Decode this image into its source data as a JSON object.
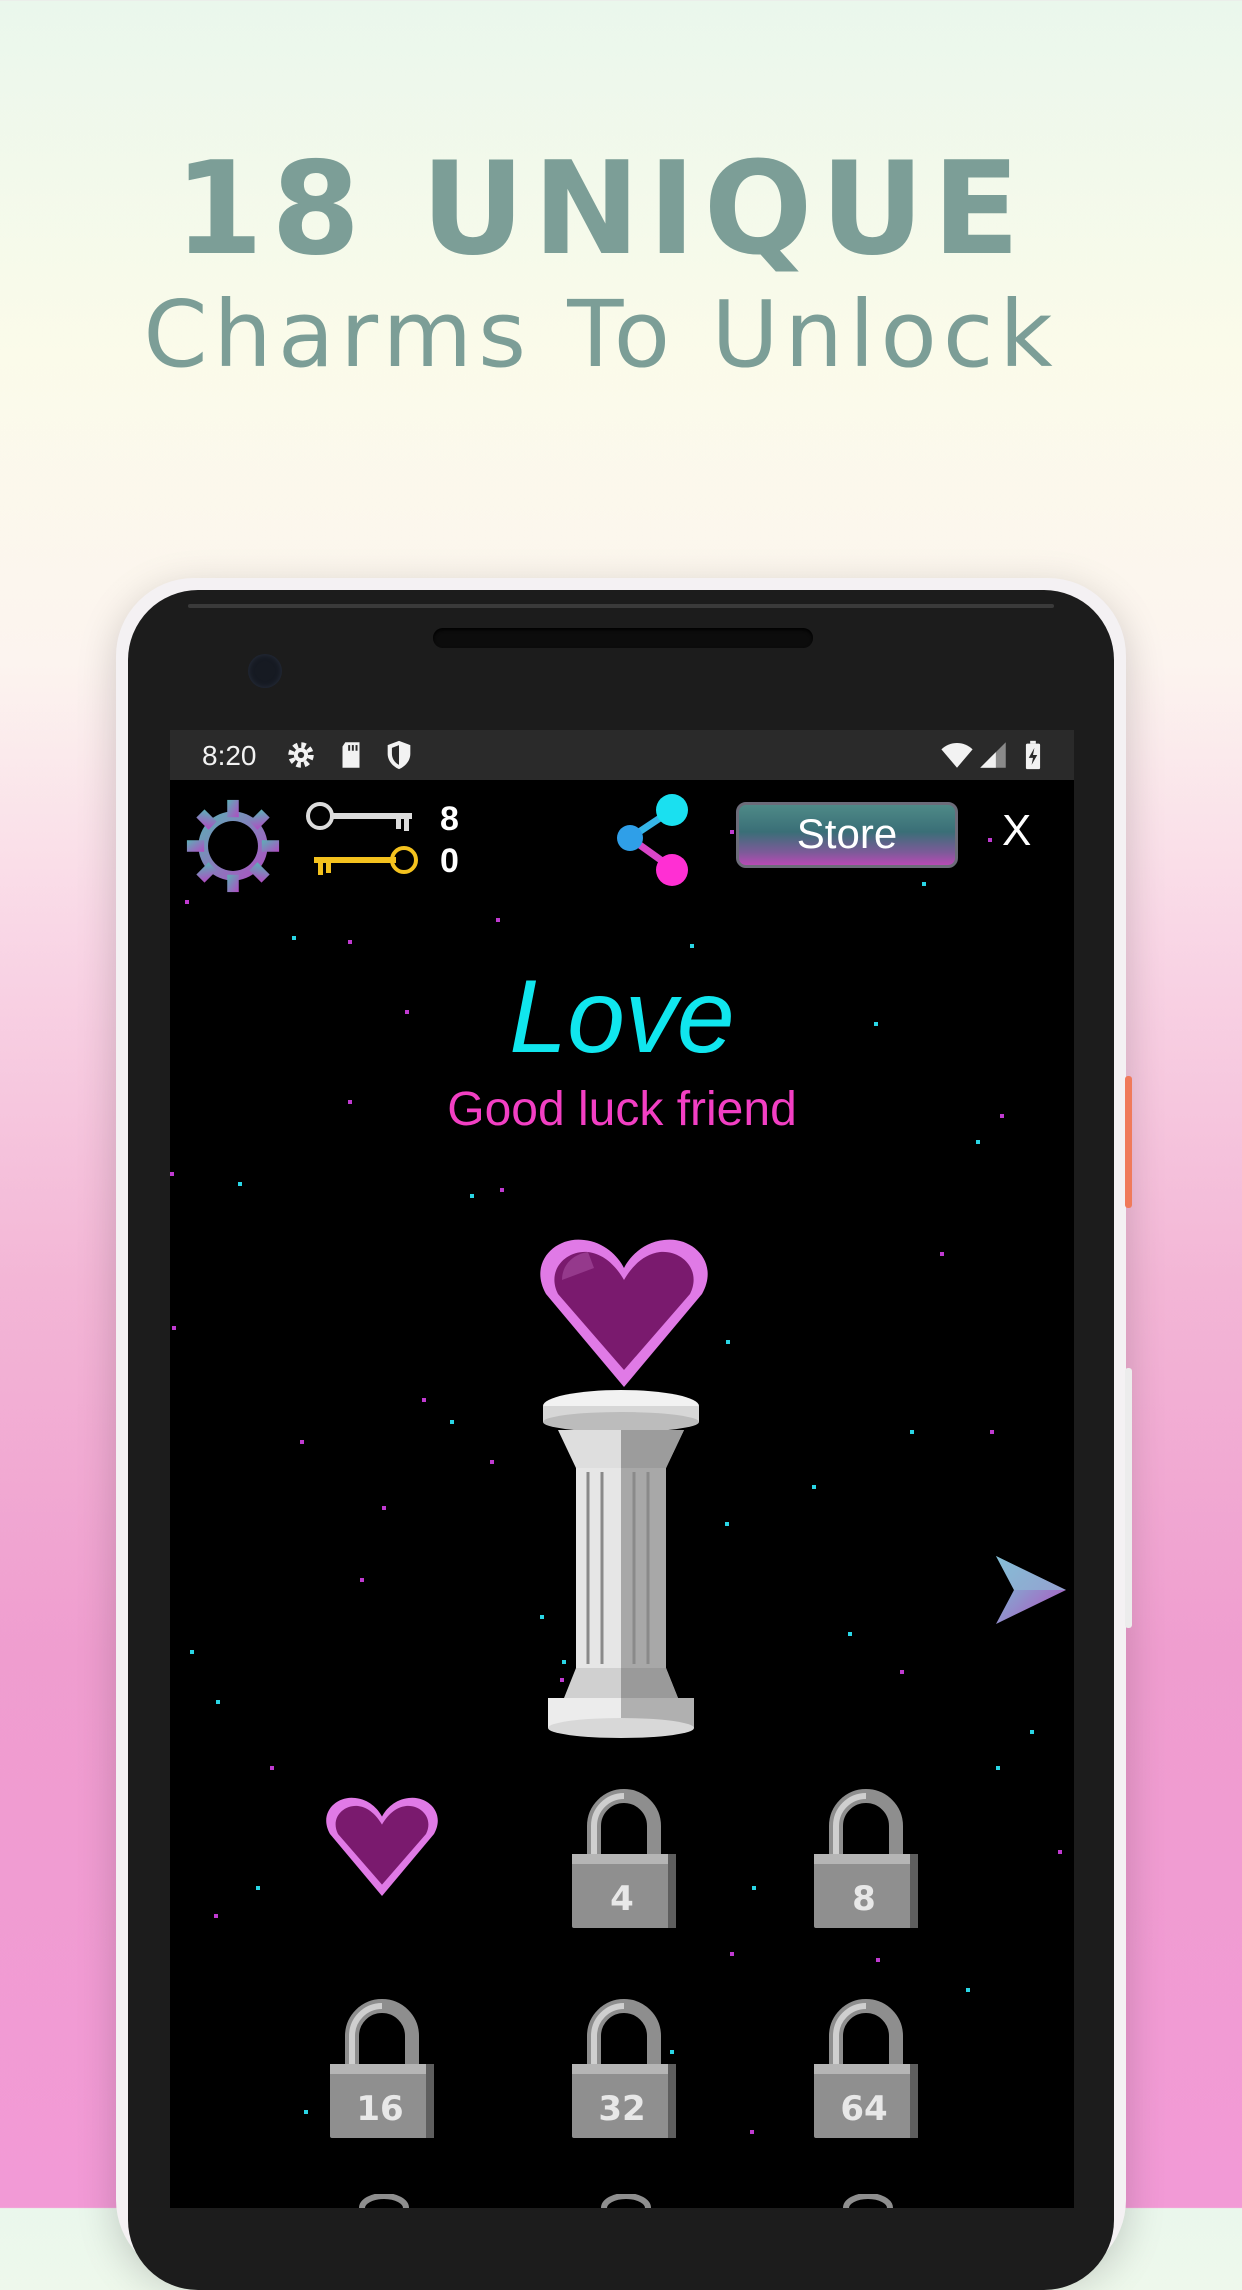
{
  "promo": {
    "headline": "18 UNIQUE",
    "subheadline": "Charms To Unlock"
  },
  "statusbar": {
    "time": "8:20",
    "icons": [
      "settings-icon",
      "sd-card-icon",
      "shield-icon",
      "wifi-icon",
      "signal-icon",
      "battery-icon"
    ]
  },
  "hud": {
    "silver_key_count": "8",
    "gold_key_count": "0",
    "store_label": "Store",
    "close_label": "X"
  },
  "charm": {
    "name": "Love",
    "message": "Good luck friend"
  },
  "charm_grid": [
    {
      "type": "unlocked",
      "icon": "heart-icon"
    },
    {
      "type": "locked",
      "keys_required": "4"
    },
    {
      "type": "locked",
      "keys_required": "8"
    },
    {
      "type": "locked",
      "keys_required": "16"
    },
    {
      "type": "locked",
      "keys_required": "32"
    },
    {
      "type": "locked",
      "keys_required": "64"
    }
  ],
  "colors": {
    "headline": "#7c9e97",
    "charm_title": "#10e6ee",
    "charm_message": "#f23fc3",
    "heart": "#7a1a6e"
  }
}
